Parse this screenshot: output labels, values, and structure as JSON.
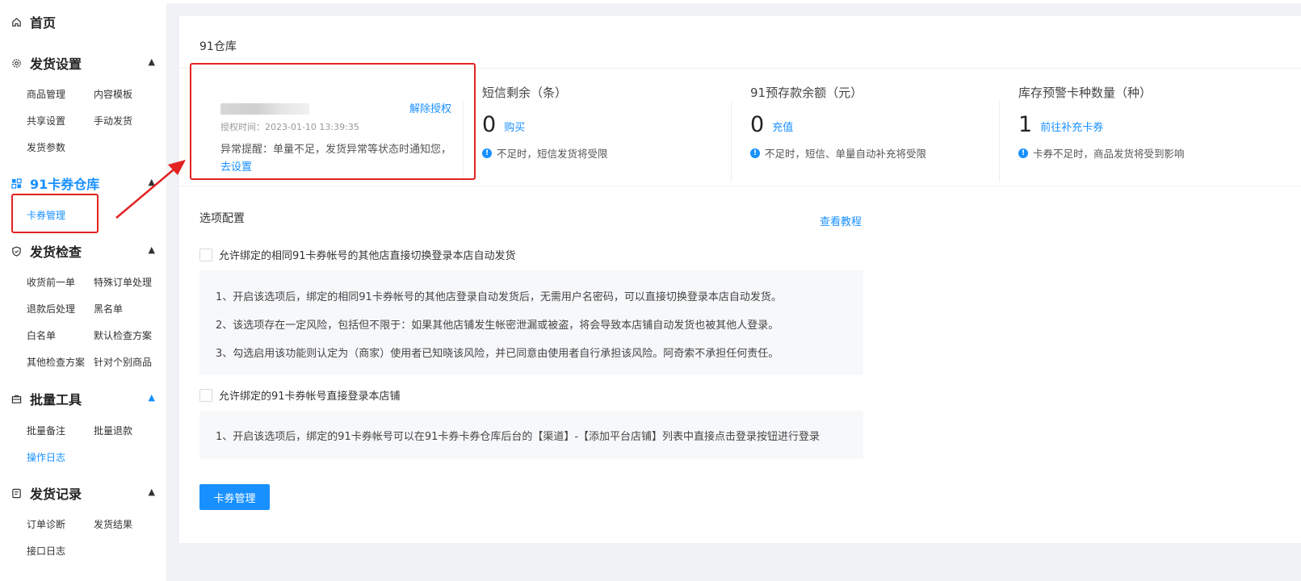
{
  "sidebar": {
    "home": {
      "label": "首页",
      "icon": "home-icon"
    },
    "groups": [
      {
        "key": "ship-settings",
        "label": "发货设置",
        "icon": "gear-icon",
        "items": [
          "商品管理",
          "内容模板",
          "共享设置",
          "手动发货",
          "发货参数"
        ]
      },
      {
        "key": "card-warehouse",
        "label": "91卡券仓库",
        "icon": "grid-icon",
        "items": [
          "卡券管理"
        ]
      },
      {
        "key": "ship-check",
        "label": "发货检查",
        "icon": "shield-icon",
        "items": [
          "收货前一单",
          "特殊订单处理",
          "退款后处理",
          "黑名单",
          "白名单",
          "默认检查方案",
          "其他检查方案",
          "针对个别商品"
        ]
      },
      {
        "key": "batch-tools",
        "label": "批量工具",
        "icon": "toolbox-icon",
        "items": [
          "批量备注",
          "批量退款",
          "操作日志"
        ]
      },
      {
        "key": "ship-records",
        "label": "发货记录",
        "icon": "document-icon",
        "items": [
          "订单诊断",
          "发货结果",
          "接口日志"
        ]
      }
    ]
  },
  "main": {
    "title": "91仓库",
    "auth": {
      "revoke": "解除授权",
      "time": "授权时间：2023-01-10 13:39:35",
      "warn_text": "异常提醒：单量不足，发货异常等状态时通知您，",
      "warn_link": "去设置"
    },
    "stats": [
      {
        "title": "短信剩余（条）",
        "value": "0",
        "link": "购买",
        "tip": "不足时，短信发货将受限"
      },
      {
        "title": "91预存款余额（元）",
        "value": "0",
        "link": "充值",
        "tip": "不足时，短信、单量自动补充将受限"
      },
      {
        "title": "库存预警卡种数量（种）",
        "value": "1",
        "link": "前往补充卡券",
        "tip": "卡券不足时，商品发货将受到影响"
      }
    ],
    "options": {
      "title": "选项配置",
      "tutorial": "查看教程",
      "opt1": {
        "label": "允许绑定的相同91卡券帐号的其他店直接切换登录本店自动发货",
        "lines": [
          "1、开启该选项后，绑定的相同91卡券帐号的其他店登录自动发货后，无需用户名密码，可以直接切换登录本店自动发货。",
          "2、该选项存在一定风险，包括但不限于：如果其他店铺发生帐密泄漏或被盗，将会导致本店铺自动发货也被其他人登录。",
          "3、勾选启用该功能则认定为（商家）使用者已知晓该风险，并已同意由使用者自行承担该风险。阿奇索不承担任何责任。"
        ]
      },
      "opt2": {
        "label": "允许绑定的91卡券帐号直接登录本店铺",
        "lines": [
          "1、开启该选项后，绑定的91卡券帐号可以在91卡券卡券仓库后台的【渠道】-【添加平台店铺】列表中直接点击登录按钮进行登录"
        ]
      }
    },
    "button": "卡券管理"
  },
  "colors": {
    "accent": "#1890ff",
    "annotation": "#e32222"
  }
}
